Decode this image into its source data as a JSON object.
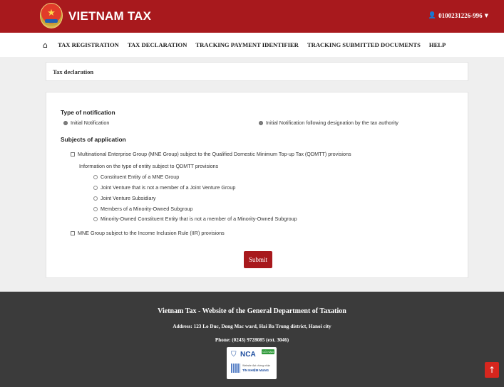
{
  "header": {
    "brand": "VIETNAM TAX",
    "account": "0100231226-996"
  },
  "nav": {
    "items": [
      "TAX REGISTRATION",
      "TAX DECLARATION",
      "TRACKING PAYMENT IDENTIFIER",
      "TRACKING SUBMITTED DOCUMENTS",
      "HELP"
    ]
  },
  "breadcrumb": "Tax declaration",
  "form": {
    "notification_label": "Type of notification",
    "notification_options": [
      {
        "label": "Initial Notification",
        "selected": true
      },
      {
        "label": "Initial Notification following designation by the tax authority",
        "selected": false
      }
    ],
    "subjects_label": "Subjects of application",
    "qdmtt_checkbox": "Multinational Enterprise Group (MNE Group) subject to the Qualified Domestic Minimum Top-up Tax (QDMTT) provisions",
    "entity_info_label": "Information on the type of entity subject to QDMTT provisions",
    "entity_options": [
      "Constituent Entity of a MNE Group",
      "Joint Venture that is not a member of a Joint Venture Group",
      "Joint Venture Subsidiary",
      "Members of a Minority-Owned Subgroup",
      "Minority-Owned Constituent Entity that is not a member of a Minority-Owned Subgroup"
    ],
    "iir_checkbox": "MNE Group subject to the Income Inclusion Rule (IIR) provisions",
    "submit_label": "Submit"
  },
  "footer": {
    "title": "Vietnam Tax - Website of the General Department of Taxation",
    "address": "Address: 123 Lo Duc, Dong Mac ward, Hai Ba Trung district, Hanoi city",
    "phone": "Phone: (0243) 9728085 (ext. 3046)",
    "badge_brand": "NCA",
    "badge_tag": "CÓ HẠN",
    "badge_cert": "Website đạt chứng nhận",
    "badge_trust": "TÍN NHIỆM MẠNG"
  },
  "colors": {
    "brand_red": "#a8191d",
    "footer_bg": "#3b3b3b"
  },
  "icons": [
    "home-icon",
    "user-icon",
    "chevron-down-icon",
    "arrow-up-icon",
    "shield-icon"
  ]
}
